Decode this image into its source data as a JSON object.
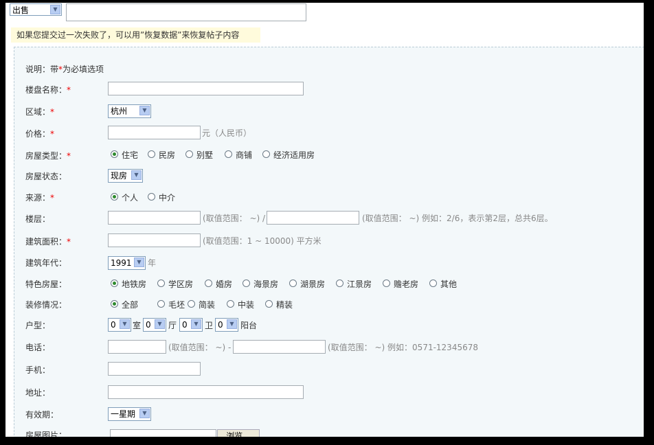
{
  "top": {
    "type_select": "出售"
  },
  "notice": "如果您提交过一次失败了，可以用”恢复数据”来恢复帖子内容",
  "form": {
    "intro_prefix": "说明：带",
    "intro_star": "*",
    "intro_suffix": "为必填选项",
    "required_mark": "*",
    "project_name": {
      "label": "楼盘名称："
    },
    "district": {
      "label": "区域：",
      "value": "杭州"
    },
    "price": {
      "label": "价格：",
      "unit": "元（人民币）"
    },
    "house_type": {
      "label": "房屋类型：",
      "options": [
        "住宅",
        "民房",
        "别墅",
        "商铺",
        "经济适用房"
      ],
      "selected": 0
    },
    "status": {
      "label": "房屋状态：",
      "value": "现房"
    },
    "source": {
      "label": "来源：",
      "options": [
        "个人",
        "中介"
      ],
      "selected": 0
    },
    "floor": {
      "label": "楼层：",
      "hint1": "(取值范围：  ~) /",
      "hint2": "(取值范围：  ~) 例如：2/6，表示第2层，总共6层。"
    },
    "area": {
      "label": "建筑面积：",
      "hint": "(取值范围：1 ~ 10000) 平方米"
    },
    "year": {
      "label": "建筑年代：",
      "value": "1991",
      "unit": "年"
    },
    "feature": {
      "label": "特色房屋：",
      "options": [
        "地铁房",
        "学区房",
        "婚房",
        "海景房",
        "湖景房",
        "江景房",
        "赡老房",
        "其他"
      ],
      "selected": 0
    },
    "decoration": {
      "label": "装修情况：",
      "options": [
        "全部",
        "毛坯",
        "简装",
        "中装",
        "精装"
      ],
      "selected": 0
    },
    "layout": {
      "label": "户型：",
      "room": "0",
      "room_unit": "室",
      "hall": "0",
      "hall_unit": "厅",
      "bath": "0",
      "bath_unit": "卫",
      "balcony": "0",
      "balcony_unit": "阳台"
    },
    "phone": {
      "label": "电话：",
      "hint1": "(取值范围：  ~) -",
      "hint2": "(取值范围：  ~) 例如：0571-12345678"
    },
    "mobile": {
      "label": "手机："
    },
    "address": {
      "label": "地址："
    },
    "validity": {
      "label": "有效期：",
      "value": "一星期"
    },
    "photo": {
      "label": "房屋图片：",
      "browse": "浏览..."
    }
  }
}
